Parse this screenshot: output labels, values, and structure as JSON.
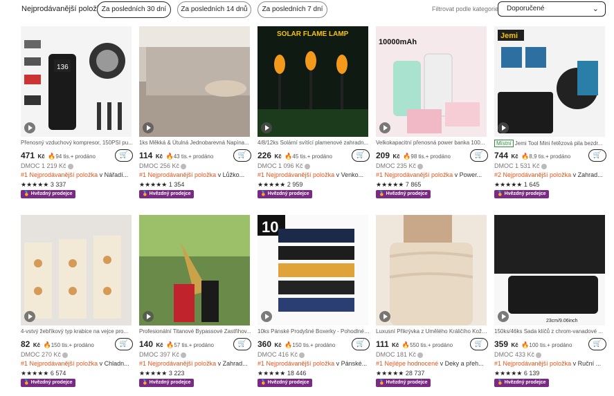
{
  "header": {
    "title": "Nejprodávanější položky",
    "pills": [
      "Za posledních 30 dní",
      "Za posledních 14 dnů",
      "Za posledních 7 dní"
    ],
    "filter_label": "Filtrovat podle kategorie",
    "sort_value": "Doporučené"
  },
  "badge_label": "Hvězdný prodejce",
  "products": [
    {
      "title": "Přenosný vzduchový kompresor, 150PSI pu...",
      "price": "471",
      "kc": "Kč",
      "sold": "94 tis.+ prodáno",
      "old": "DMOC 1 219 Kč",
      "rank": "#1 Nejprodávanější položka",
      "cat": "v Nářadí...",
      "reviews": "3 337",
      "thumb_text": ""
    },
    {
      "title": "1ks Měkká & Útulná Jednobarevná Napína...",
      "price": "114",
      "kc": "Kč",
      "sold": "43 tis.+ prodáno",
      "old": "DMOC 256 Kč",
      "rank": "#1 Nejprodávanější položka",
      "cat": "v Lůžko...",
      "reviews": "1 354",
      "thumb_text": ""
    },
    {
      "title": "4/8/12ks Solární svítící plamenové zahradn...",
      "price": "226",
      "kc": "Kč",
      "sold": "45 tis.+ prodáno",
      "old": "DMOC 1 096 Kč",
      "rank": "#1 Nejprodávanější položka",
      "cat": "v Venko...",
      "reviews": "2 959",
      "thumb_text": "SOLAR FLAME LAMP"
    },
    {
      "title": "Velkokapacitní přenosná power banka 100...",
      "price": "209",
      "kc": "Kč",
      "sold": "98 tis.+ prodáno",
      "old": "DMOC 235 Kč",
      "rank": "#1 Nejprodávanější položka",
      "cat": "v Power...",
      "reviews": "7 865",
      "thumb_text": "10000mAh"
    },
    {
      "title": "Jemi Tool Mini řetězová pila bezdr...",
      "price": "744",
      "kc": "Kč",
      "sold": "8,9 tis.+ prodáno",
      "old": "DMOC 1 531 Kč",
      "rank": "#2 Nejprodávanější položka",
      "cat": "v Zahrad...",
      "reviews": "1 645",
      "thumb_text": "Jemi",
      "local": "Místní"
    },
    {
      "title": "4-vstvý žebříkový typ krabice na vejce pro...",
      "price": "82",
      "kc": "Kč",
      "sold": "150 tis.+ prodáno",
      "old": "DMOC 270 Kč",
      "rank": "#1 Nejprodávanější položka",
      "cat": "v Chladn...",
      "reviews": "6 574",
      "thumb_text": ""
    },
    {
      "title": "Profesionální Titanové Bypassové Zastřihov...",
      "price": "140",
      "kc": "Kč",
      "sold": "57 tis.+ prodáno",
      "old": "DMOC 397 Kč",
      "rank": "#1 Nejprodávanější položka",
      "cat": "v Zahrad...",
      "reviews": "3 223",
      "thumb_text": ""
    },
    {
      "title": "10ks Pánské Prodyšné Boxerky - Pohodlné ...",
      "price": "360",
      "kc": "Kč",
      "sold": "150 tis.+ prodáno",
      "old": "DMOC 416 Kč",
      "rank": "#1 Nejprodávanější položka",
      "cat": "v Pánské...",
      "reviews": "18 446",
      "thumb_text": "10"
    },
    {
      "title": "Luxusní Přikrývka z Umělého Králičího Kože...",
      "price": "111",
      "kc": "Kč",
      "sold": "550 tis.+ prodáno",
      "old": "DMOC 181 Kč",
      "rank": "#1 Nejlépe hodnocené",
      "cat": "v Deky a přeh...",
      "reviews": "28 737",
      "thumb_text": ""
    },
    {
      "title": "150ks/46ks Sada klíčů z chrom-vanadové ...",
      "price": "359",
      "kc": "Kč",
      "sold": "100 tis.+ prodáno",
      "old": "DMOC 433 Kč",
      "rank": "#1 Nejprodávanější položka",
      "cat": "v Ruční ...",
      "reviews": "6 139",
      "thumb_text": "23cm/9.06inch"
    }
  ],
  "colors": {
    "accent": "#e4531a",
    "badge": "#7a2a85",
    "flame": "#f06a14"
  }
}
